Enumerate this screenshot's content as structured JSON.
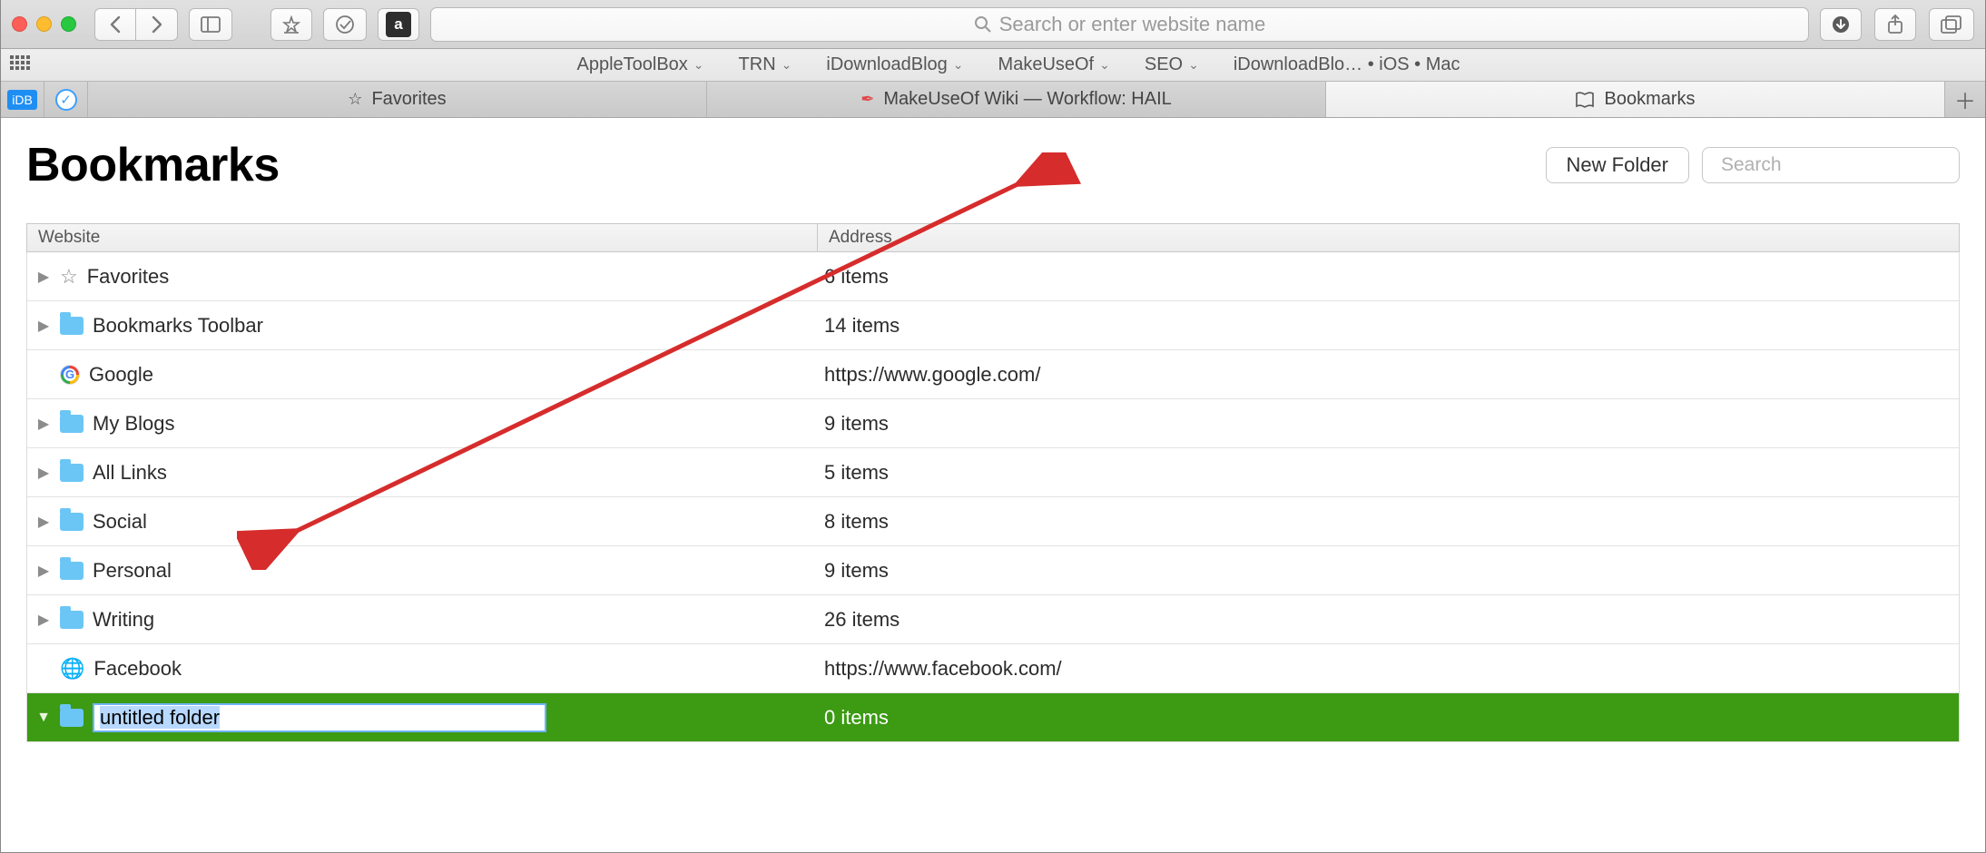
{
  "toolbar": {
    "search_placeholder": "Search or enter website name"
  },
  "favorites_bar": {
    "items": [
      {
        "label": "AppleToolBox",
        "dropdown": true
      },
      {
        "label": "TRN",
        "dropdown": true
      },
      {
        "label": "iDownloadBlog",
        "dropdown": true
      },
      {
        "label": "MakeUseOf",
        "dropdown": true
      },
      {
        "label": "SEO",
        "dropdown": true
      },
      {
        "label": "iDownloadBlo… • iOS • Mac",
        "dropdown": false
      }
    ]
  },
  "tabs": [
    {
      "label": "Favorites",
      "icon": "star"
    },
    {
      "label": "MakeUseOf Wiki — Workflow: HAIL",
      "icon": "feather"
    },
    {
      "label": "Bookmarks",
      "icon": "book",
      "active": true
    }
  ],
  "page": {
    "title": "Bookmarks",
    "new_folder_label": "New Folder",
    "search_placeholder": "Search"
  },
  "columns": {
    "website": "Website",
    "address": "Address"
  },
  "rows": [
    {
      "icon": "star",
      "name": "Favorites",
      "address": "6 items",
      "expandable": true
    },
    {
      "icon": "folder",
      "name": "Bookmarks Toolbar",
      "address": "14 items",
      "expandable": true
    },
    {
      "icon": "google",
      "name": "Google",
      "address": "https://www.google.com/",
      "expandable": false
    },
    {
      "icon": "folder",
      "name": "My Blogs",
      "address": "9 items",
      "expandable": true
    },
    {
      "icon": "folder",
      "name": "All Links",
      "address": "5 items",
      "expandable": true
    },
    {
      "icon": "folder",
      "name": "Social",
      "address": "8 items",
      "expandable": true
    },
    {
      "icon": "folder",
      "name": "Personal",
      "address": "9 items",
      "expandable": true
    },
    {
      "icon": "folder",
      "name": "Writing",
      "address": "26 items",
      "expandable": true
    },
    {
      "icon": "globe",
      "name": "Facebook",
      "address": "https://www.facebook.com/",
      "expandable": false
    },
    {
      "icon": "folder",
      "name": "untitled folder",
      "address": "0 items",
      "expandable": true,
      "selected": true,
      "editing": true,
      "open": true
    }
  ]
}
